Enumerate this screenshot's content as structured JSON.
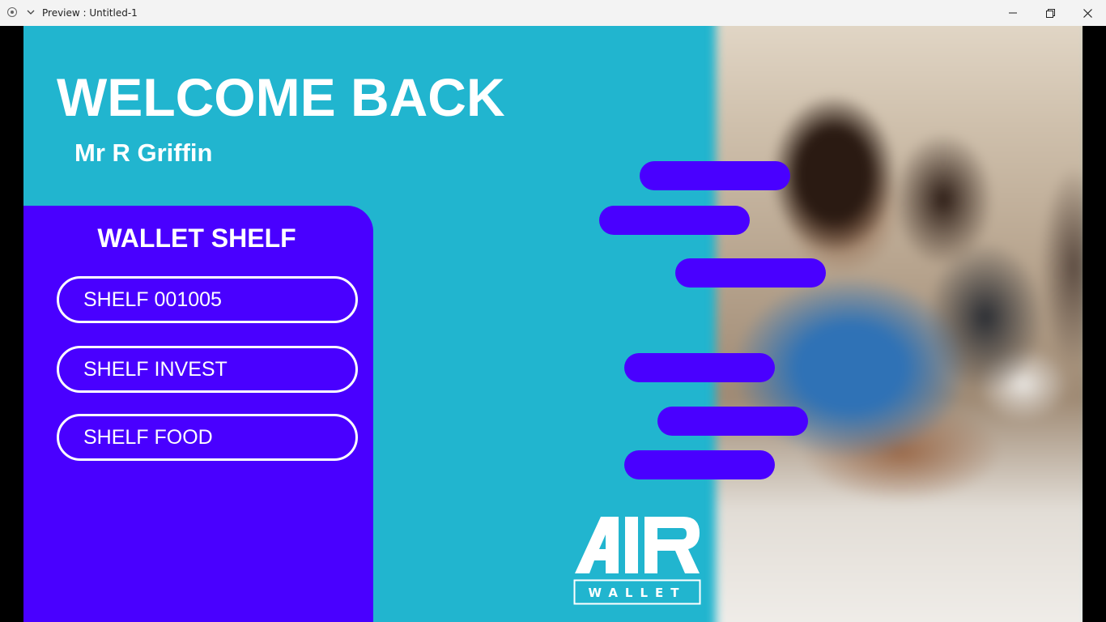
{
  "window": {
    "title": "Preview : Untitled-1",
    "controls": {
      "minimize_icon": "minimize-icon",
      "restore_icon": "restore-icon",
      "close_icon": "close-icon"
    }
  },
  "header": {
    "title": "WELCOME BACK",
    "user_name": "Mr R Griffin"
  },
  "wallet_shelf": {
    "heading": "WALLET SHELF",
    "items": [
      {
        "label": "SHELF 001005"
      },
      {
        "label": "SHELF INVEST"
      },
      {
        "label": "SHELF FOOD"
      }
    ]
  },
  "menu_pills": {
    "count": 6,
    "color": "#4900ff"
  },
  "logo": {
    "word": "AIR",
    "tagline": "WALLET"
  },
  "colors": {
    "background": "#21b5cf",
    "panel": "#4900ff",
    "text": "#ffffff"
  },
  "background_image": "blurred-photo-of-smiling-person-using-phone"
}
